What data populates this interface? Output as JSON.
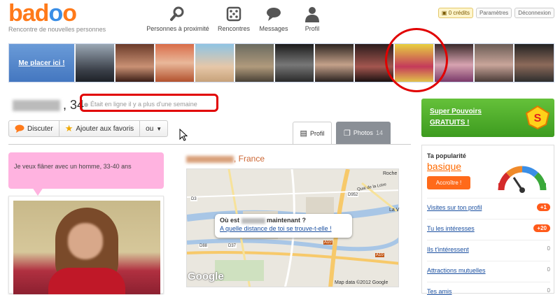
{
  "header": {
    "logo_text": "badoo",
    "tagline": "Rencontre de nouvelles personnes",
    "nav": [
      {
        "label": "Personnes à proximité",
        "icon": "magnifier-icon"
      },
      {
        "label": "Rencontres",
        "icon": "dice-icon"
      },
      {
        "label": "Messages",
        "icon": "speech-bubble-icon"
      },
      {
        "label": "Profil",
        "icon": "person-icon"
      }
    ],
    "credits": "0 crédits",
    "settings": "Paramètres",
    "logout": "Déconnexion"
  },
  "strip": {
    "place_me": "Me placer ici !"
  },
  "profile": {
    "age": ", 34",
    "status": "Était en ligne il y a plus d'une semaine",
    "actions": {
      "chat": "Discuter",
      "favorite": "Ajouter aux favoris",
      "more": "ou"
    },
    "tabs": {
      "profile": "Profil",
      "photos": "Photos",
      "photo_count": "14"
    },
    "bubble": "Je veux flâner avec un homme, 33-40 ans",
    "location_suffix": ", France",
    "map": {
      "question_prefix": "Où est",
      "question_suffix": "maintenant ?",
      "link": "A quelle distance de toi se trouve-t-elle !",
      "google": "Google",
      "copyright": "Map data ©2012 Google",
      "labels": [
        "Roche",
        "Quai de la Loire",
        "D952",
        "D3",
        "D88",
        "D37",
        "A10",
        "A10",
        "La V"
      ]
    }
  },
  "sidebar": {
    "super_powers_line1": "Super Pouvoirs",
    "super_powers_line2": "GRATUITS !",
    "popularity_label": "Ta popularité",
    "popularity_value": "basique",
    "boost_button": "Accroître !",
    "stats": [
      {
        "label": "Visites sur ton profil",
        "value": "+1",
        "badge": true
      },
      {
        "label": "Tu les intéresses",
        "value": "+20",
        "badge": true
      },
      {
        "label": "Ils t'intéressent",
        "value": "0",
        "badge": false
      },
      {
        "label": "Attractions mutuelles",
        "value": "0",
        "badge": false
      },
      {
        "label": "Tes amis",
        "value": "0",
        "badge": false
      }
    ]
  },
  "colors": {
    "brand_orange": "#ff7a1a",
    "brand_blue": "#3a8ee6",
    "highlight_red": "#e10000",
    "link_blue": "#1a4fa0"
  }
}
